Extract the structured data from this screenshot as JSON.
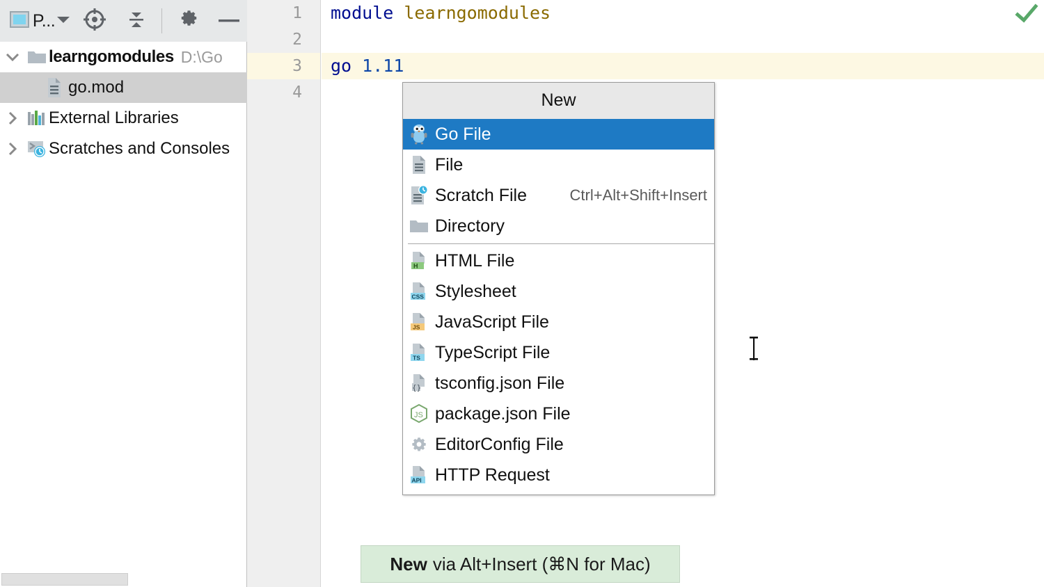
{
  "panel": {
    "toolbar": {
      "project_label": "P...",
      "project_icon": "project-window-icon",
      "locate_icon": "locate-target-icon",
      "collapse_icon": "collapse-all-icon",
      "settings_icon": "gear-icon",
      "hide_icon": "minimize-icon"
    },
    "tree": [
      {
        "label": "learngomodules",
        "path": "D:\\Go",
        "icon": "folder-icon",
        "twisty": "chevron-down-icon",
        "selected": false,
        "bold": true
      },
      {
        "label": "go.mod",
        "path": "",
        "icon": "gomod-file-icon",
        "twisty": "",
        "selected": true,
        "bold": false
      },
      {
        "label": "External Libraries",
        "path": "",
        "icon": "libraries-icon",
        "twisty": "chevron-right-icon",
        "selected": false,
        "bold": false
      },
      {
        "label": "Scratches and Consoles",
        "path": "",
        "icon": "scratches-icon",
        "twisty": "chevron-right-icon",
        "selected": false,
        "bold": false
      }
    ]
  },
  "editor": {
    "line_numbers": [
      "1",
      "2",
      "3",
      "4"
    ],
    "current_line": 3,
    "lines": [
      {
        "kw": "module",
        "ident": "learngomodules",
        "val": ""
      },
      {
        "kw": "",
        "ident": "",
        "val": ""
      },
      {
        "kw": "go",
        "ident": "",
        "val": "1.11"
      },
      {
        "kw": "",
        "ident": "",
        "val": ""
      }
    ],
    "inspection_status": "ok-checkmark-icon",
    "caret": "text-caret-icon"
  },
  "menu": {
    "title": "New",
    "group1": [
      {
        "label": "Go File",
        "shortcut": "",
        "icon": "go-gopher-icon",
        "highlight": true
      },
      {
        "label": "File",
        "shortcut": "",
        "icon": "file-icon",
        "highlight": false
      },
      {
        "label": "Scratch File",
        "shortcut": "Ctrl+Alt+Shift+Insert",
        "icon": "scratch-file-icon",
        "highlight": false
      },
      {
        "label": "Directory",
        "shortcut": "",
        "icon": "folder-icon",
        "highlight": false
      }
    ],
    "group2": [
      {
        "label": "HTML File",
        "shortcut": "",
        "icon": "html-file-icon",
        "highlight": false
      },
      {
        "label": "Stylesheet",
        "shortcut": "",
        "icon": "css-file-icon",
        "highlight": false
      },
      {
        "label": "JavaScript File",
        "shortcut": "",
        "icon": "js-file-icon",
        "highlight": false
      },
      {
        "label": "TypeScript File",
        "shortcut": "",
        "icon": "ts-file-icon",
        "highlight": false
      },
      {
        "label": "tsconfig.json File",
        "shortcut": "",
        "icon": "tsconfig-file-icon",
        "highlight": false
      },
      {
        "label": "package.json File",
        "shortcut": "",
        "icon": "nodejs-package-icon",
        "highlight": false
      },
      {
        "label": "EditorConfig File",
        "shortcut": "",
        "icon": "gear-icon",
        "highlight": false
      },
      {
        "label": "HTTP Request",
        "shortcut": "",
        "icon": "http-request-icon",
        "highlight": false
      }
    ]
  },
  "caption": {
    "strong": "New",
    "rest": "via Alt+Insert (⌘N for Mac)"
  },
  "colors": {
    "selection_blue": "#1e7ac4",
    "current_line_yellow": "#fdf8e3",
    "caption_green": "#d9ecd9",
    "toolbar_gray": "#e6e8e9",
    "tree_selected_gray": "#d0d0d0",
    "ok_green": "#59a869"
  }
}
